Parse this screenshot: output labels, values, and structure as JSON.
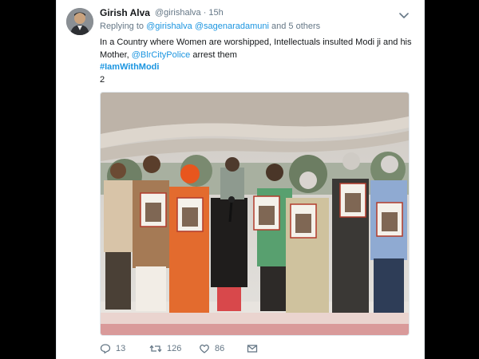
{
  "tweet": {
    "author_name": "Girish Alva",
    "author_meta": "@girishalva · 15h",
    "replying_prefix": "Replying to",
    "reply_handle_1": "@girishalva",
    "reply_handle_2": "@sagenaradamuni",
    "reply_suffix": "and 5 others",
    "text_line1": "In a Country where Women are worshipped, Intellectuals insulted Modi ji and his",
    "text_line2_prefix": "Mother,",
    "text_mention": "@BlrCityPolice",
    "text_line2_suffix": "arrest them",
    "hashtag": "#IamWithModi",
    "extra_line": "2"
  },
  "actions": {
    "reply_count": "13",
    "retweet_count": "126",
    "like_count": "86"
  },
  "icons": {
    "menu": "chevron-down-icon",
    "reply": "reply-icon",
    "retweet": "retweet-icon",
    "like": "heart-icon",
    "message": "envelope-icon"
  },
  "colors": {
    "link": "#1b95e0",
    "text": "#14171a",
    "muted": "#657786",
    "background": "#000000"
  }
}
